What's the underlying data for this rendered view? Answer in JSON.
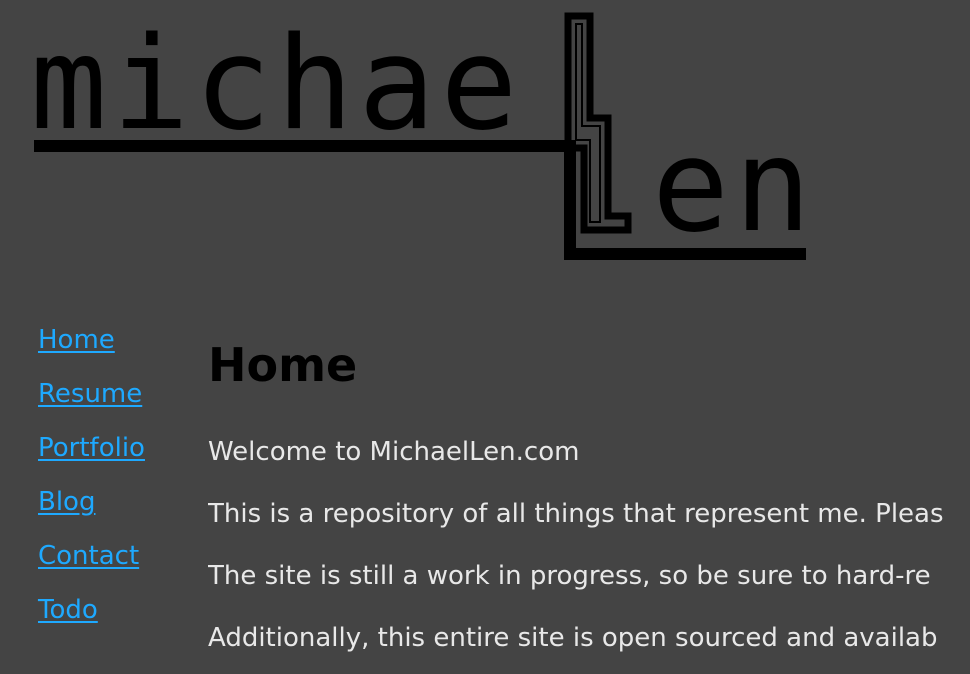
{
  "logo": {
    "top_text": "michae",
    "bottom_text": "en"
  },
  "nav": {
    "items": [
      {
        "label": "Home"
      },
      {
        "label": "Resume"
      },
      {
        "label": "Portfolio"
      },
      {
        "label": "Blog"
      },
      {
        "label": "Contact"
      },
      {
        "label": "Todo"
      }
    ]
  },
  "main": {
    "title": "Home",
    "paragraphs": [
      "Welcome to MichaelLen.com",
      "This is a repository of all things that represent me. Pleas",
      "The site is still a work in progress, so be sure to hard-re",
      "Additionally, this entire site is open sourced and availab"
    ]
  },
  "colors": {
    "background": "#444444",
    "link": "#1ea9ff",
    "text": "#e8e8e8",
    "heading": "#000000"
  }
}
